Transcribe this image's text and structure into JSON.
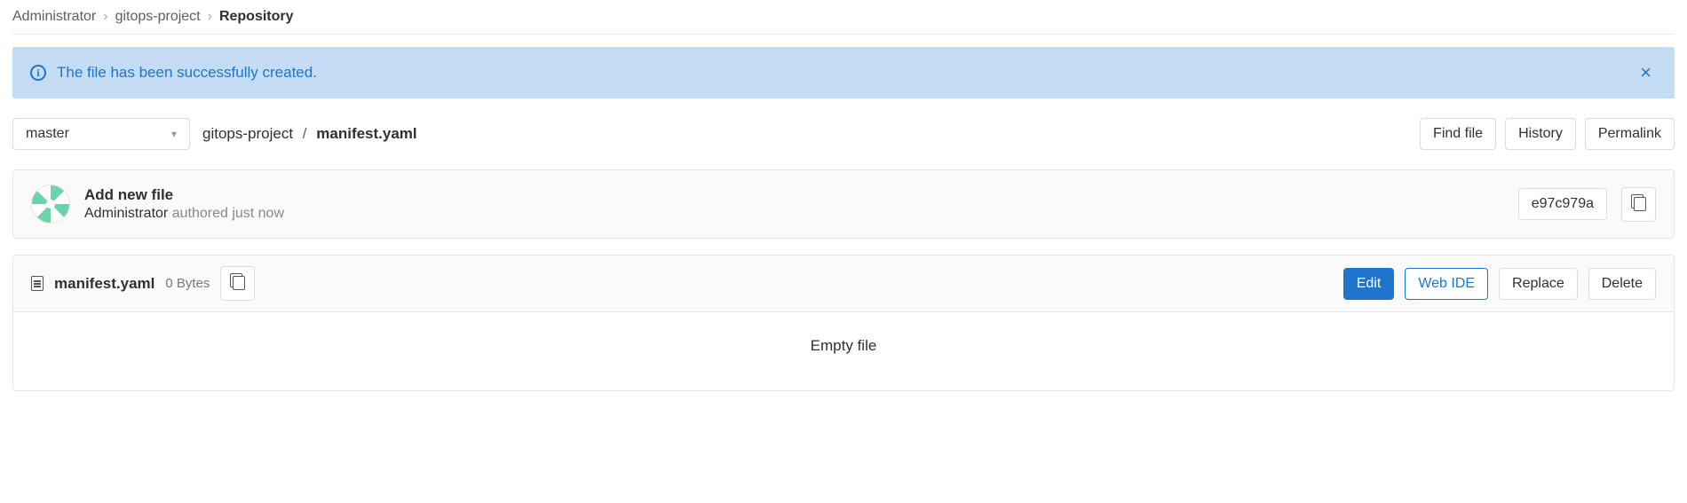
{
  "breadcrumb": {
    "items": [
      "Administrator",
      "gitops-project"
    ],
    "current": "Repository"
  },
  "alert": {
    "message": "The file has been successfully created."
  },
  "branch": {
    "selected": "master"
  },
  "path": {
    "repo": "gitops-project",
    "file": "manifest.yaml"
  },
  "actions": {
    "find": "Find file",
    "history": "History",
    "permalink": "Permalink"
  },
  "commit": {
    "title": "Add new file",
    "author": "Administrator",
    "rest": "authored just now",
    "sha": "e97c979a"
  },
  "file": {
    "name": "manifest.yaml",
    "size": "0 Bytes",
    "buttons": {
      "edit": "Edit",
      "webide": "Web IDE",
      "replace": "Replace",
      "delete": "Delete"
    },
    "body": "Empty file"
  }
}
